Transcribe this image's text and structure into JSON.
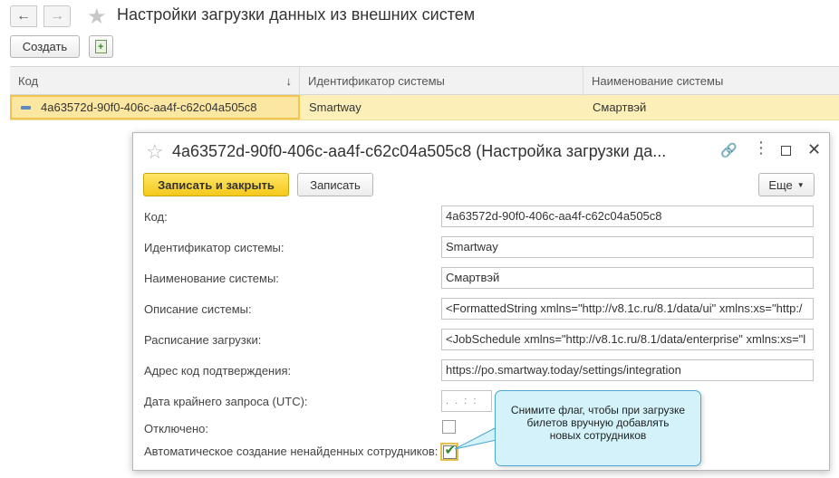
{
  "window": {
    "title": "Настройки загрузки данных из внешних систем"
  },
  "toolbar": {
    "create_label": "Создать",
    "back_icon": "←",
    "forward_icon": "→",
    "favorite_icon": "★"
  },
  "table": {
    "columns": [
      "Код",
      "Идентификатор системы",
      "Наименование системы"
    ],
    "sort_icon": "↓",
    "rows": [
      {
        "code": "4a63572d-90f0-406c-aa4f-c62c04a505c8",
        "system_id": "Smartway",
        "system_name": "Смартвэй"
      }
    ]
  },
  "dialog": {
    "title": "4a63572d-90f0-406c-aa4f-c62c04a505c8 (Настройка загрузки да...",
    "favorite_icon": "☆",
    "link_icon": "🔗",
    "menu_icon": "⋮",
    "close_icon": "✕",
    "save_close_label": "Записать и закрыть",
    "save_label": "Записать",
    "more_label": "Еще",
    "more_caret": "▼",
    "fields": {
      "code": {
        "label": "Код:",
        "value": "4a63572d-90f0-406c-aa4f-c62c04a505c8"
      },
      "system_id": {
        "label": "Идентификатор системы:",
        "value": "Smartway"
      },
      "system_name": {
        "label": "Наименование системы:",
        "value": "Смартвэй"
      },
      "description": {
        "label": "Описание системы:",
        "value": "<FormattedString xmlns=\"http://v8.1c.ru/8.1/data/ui\" xmlns:xs=\"http:/"
      },
      "schedule": {
        "label": "Расписание загрузки:",
        "value": "<JobSchedule xmlns=\"http://v8.1c.ru/8.1/data/enterprise\" xmlns:xs=\"l"
      },
      "confirm_url": {
        "label": "Адрес код подтверждения:",
        "value": "https://po.smartway.today/settings/integration"
      },
      "last_request": {
        "label": "Дата крайнего запроса (UTC):",
        "value": ". .   :  :"
      },
      "disabled": {
        "label": "Отключено:",
        "checked": false
      },
      "auto_create": {
        "label": "Автоматическое создание ненайденных сотрудников:",
        "checked": true,
        "check_mark": "✔"
      }
    }
  },
  "tooltip": {
    "text_line1": "Снимите флаг, чтобы при загрузке",
    "text_line2": "билетов вручную добавлять",
    "text_line3": "новых сотрудников"
  },
  "colors": {
    "accent_yellow": "#f5c81a",
    "row_highlight": "#fcefb8",
    "tooltip_bg": "#d3f2f9",
    "tooltip_border": "#4da7cf",
    "check_green": "#2b8a2b"
  }
}
